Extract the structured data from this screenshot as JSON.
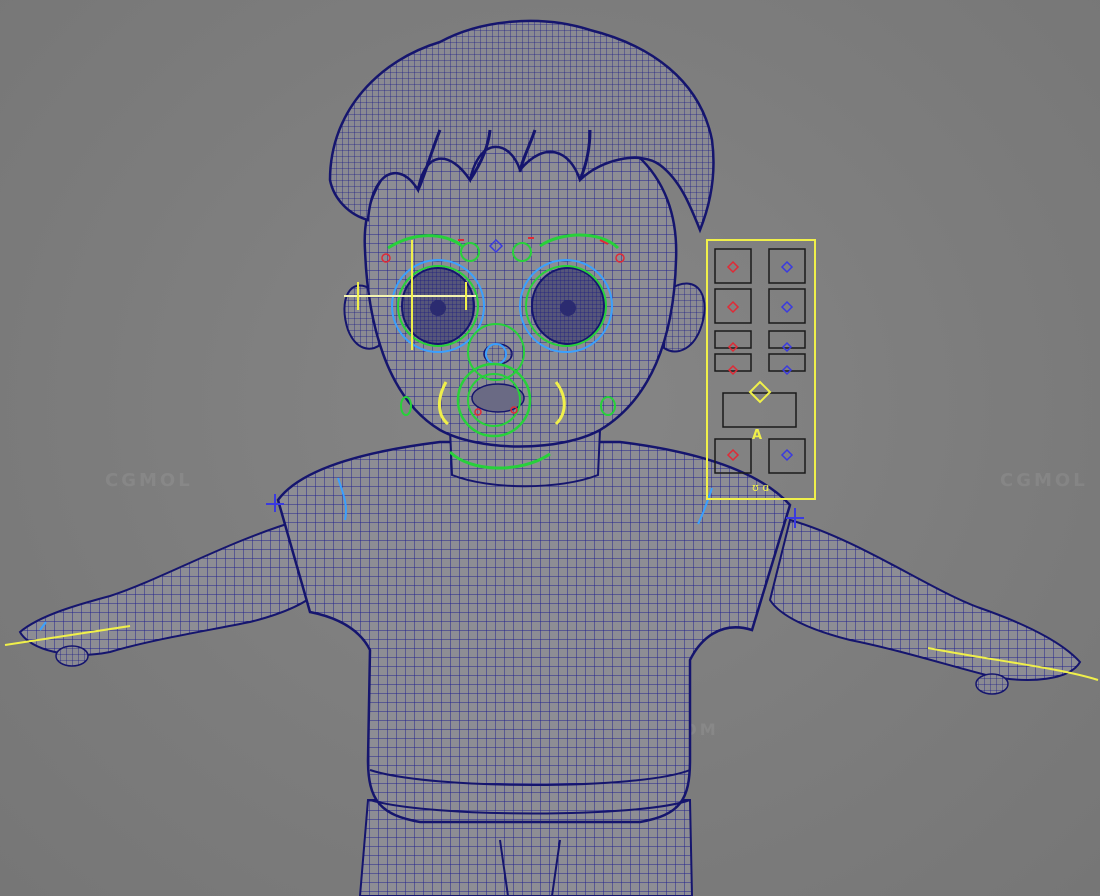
{
  "scene": {
    "subject": "3D rigged cartoon boy character in T-pose, wireframe on shaded view",
    "colors": {
      "background": "#7f7f7f",
      "mesh_fill": "#8d8d93",
      "wire": "#1e1e8a",
      "ctrl_yellow": "#f0f04a",
      "ctrl_green": "#27d13a",
      "ctrl_blue": "#3aa0ff",
      "ctrl_red": "#e02a36"
    }
  },
  "watermarks": {
    "logo_text": "CGMOL",
    "url_text": "WWW.CGMOL.COM"
  },
  "face_control_panel": {
    "title_letter": "A",
    "footer_glyphs": "ʊ ɑ"
  }
}
